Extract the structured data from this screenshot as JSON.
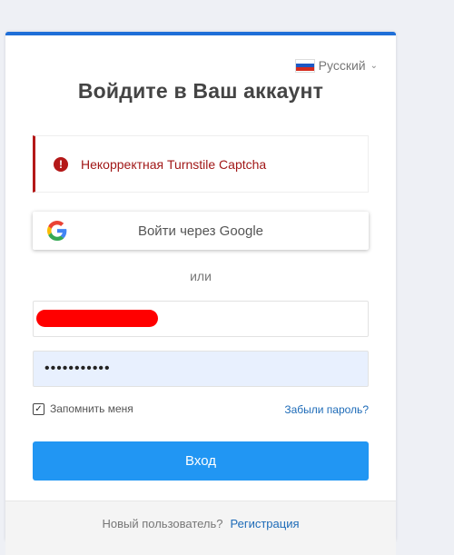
{
  "language": {
    "label": "Русский",
    "flag": "russia-flag"
  },
  "title": "Войдите в Ваш аккаунт",
  "alert": {
    "message": "Некорректная Turnstile Captcha",
    "color": "#b41818"
  },
  "google_button": {
    "label": "Войти через Google"
  },
  "divider_text": "или",
  "email": {
    "value": "",
    "redacted": true
  },
  "password": {
    "value": "•••••••••••"
  },
  "remember": {
    "label": "Запомнить меня",
    "checked": true
  },
  "forgot_link": "Забыли пароль?",
  "submit_label": "Вход",
  "footer": {
    "text": "Новый пользователь?",
    "link": "Регистрация"
  },
  "colors": {
    "accent": "#1f6fd8",
    "button": "#2196f3",
    "link": "#1d6bb8",
    "error": "#b41818"
  }
}
